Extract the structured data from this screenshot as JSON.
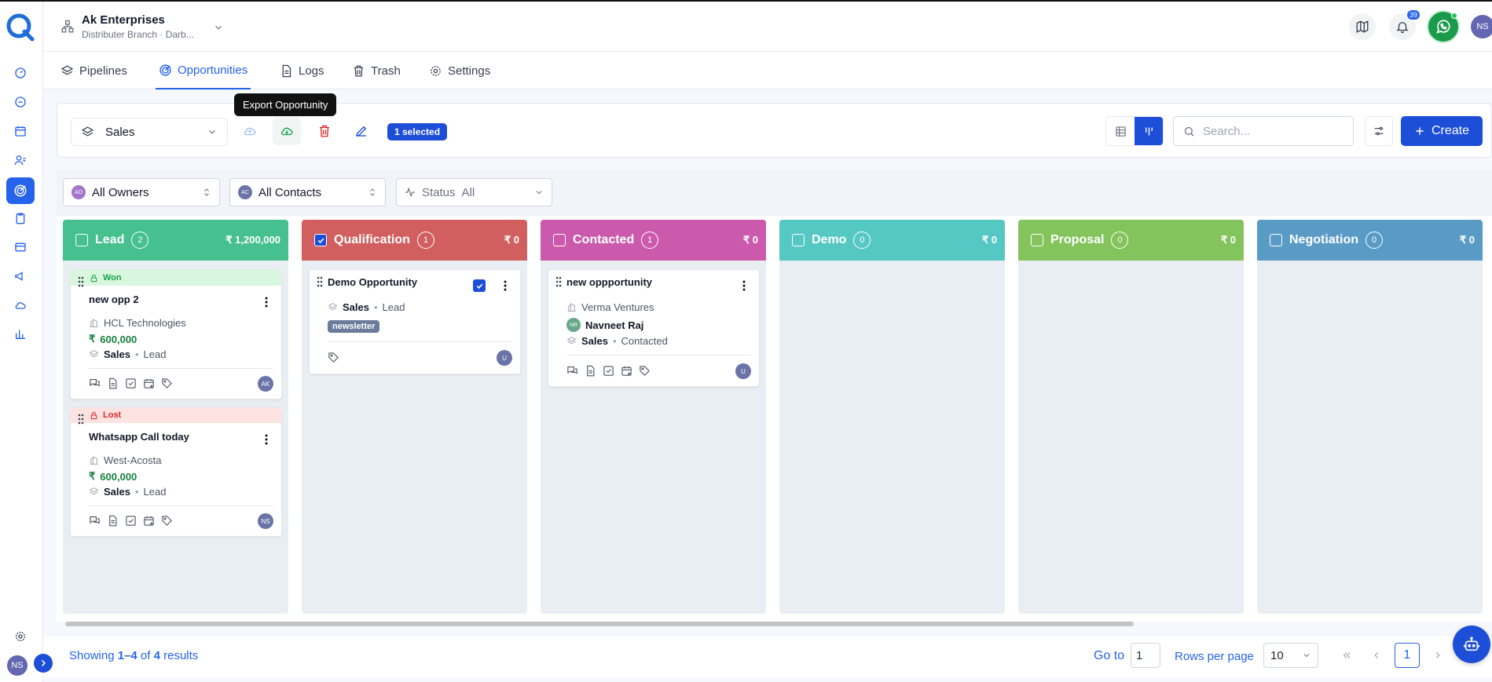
{
  "org": {
    "name": "Ak Enterprises",
    "subtitle": "Distributer Branch · Darb..."
  },
  "header": {
    "notification_count": "39",
    "avatar": "NS"
  },
  "sidebar": {
    "avatar": "NS"
  },
  "tabs": [
    {
      "label": "Pipelines",
      "icon": "layers-icon"
    },
    {
      "label": "Opportunities",
      "icon": "target-icon"
    },
    {
      "label": "Logs",
      "icon": "document-icon"
    },
    {
      "label": "Trash",
      "icon": "trash-icon"
    },
    {
      "label": "Settings",
      "icon": "gear-icon"
    }
  ],
  "toolbar": {
    "pipeline": "Sales",
    "tooltip": "Export Opportunity",
    "selected": "1 selected",
    "search_placeholder": "Search...",
    "create_label": "Create"
  },
  "filters": {
    "owners": {
      "avatar": "AO",
      "label": "All Owners"
    },
    "contacts": {
      "avatar": "AC",
      "label": "All Contacts"
    },
    "status": {
      "label": "Status",
      "value": "All"
    }
  },
  "columns": [
    {
      "title": "Lead",
      "count": "2",
      "amount": "₹ 1,200,000",
      "color": "#45c08e",
      "checked": false
    },
    {
      "title": "Qualification",
      "count": "1",
      "amount": "₹ 0",
      "color": "#d15f5f",
      "checked": true
    },
    {
      "title": "Contacted",
      "count": "1",
      "amount": "₹ 0",
      "color": "#cc5aac",
      "checked": false
    },
    {
      "title": "Demo",
      "count": "0",
      "amount": "₹ 0",
      "color": "#56c8c4",
      "checked": false
    },
    {
      "title": "Proposal",
      "count": "0",
      "amount": "₹ 0",
      "color": "#84c45c",
      "checked": false
    },
    {
      "title": "Negotiation",
      "count": "0",
      "amount": "₹ 0",
      "color": "#5a9bc6",
      "checked": false
    }
  ],
  "cards": {
    "lead1": {
      "status": "Won",
      "title": "new opp 2",
      "company": "HCL Technologies",
      "amount": "600,000",
      "pipeline": "Sales",
      "stage": "Lead",
      "avatar": "AK"
    },
    "lead2": {
      "status": "Lost",
      "title": "Whatsapp Call today",
      "company": "West-Acosta",
      "amount": "600,000",
      "pipeline": "Sales",
      "stage": "Lead",
      "avatar": "NS"
    },
    "qual1": {
      "title": "Demo Opportunity",
      "pipeline": "Sales",
      "stage": "Lead",
      "tag": "newsletter",
      "avatar": "U"
    },
    "cont1": {
      "title": "new oppportunity",
      "company": "Verma Ventures",
      "contact_avatar": "NR",
      "contact": "Navneet Raj",
      "pipeline": "Sales",
      "stage": "Contacted",
      "avatar": "U"
    }
  },
  "footer": {
    "showing_prefix": "Showing ",
    "range": "1–4",
    "of": " of ",
    "total": "4",
    "suffix": " results",
    "goto_label": "Go to",
    "goto_value": "1",
    "rows_label": "Rows per page",
    "rows_value": "10",
    "current_page": "1"
  }
}
